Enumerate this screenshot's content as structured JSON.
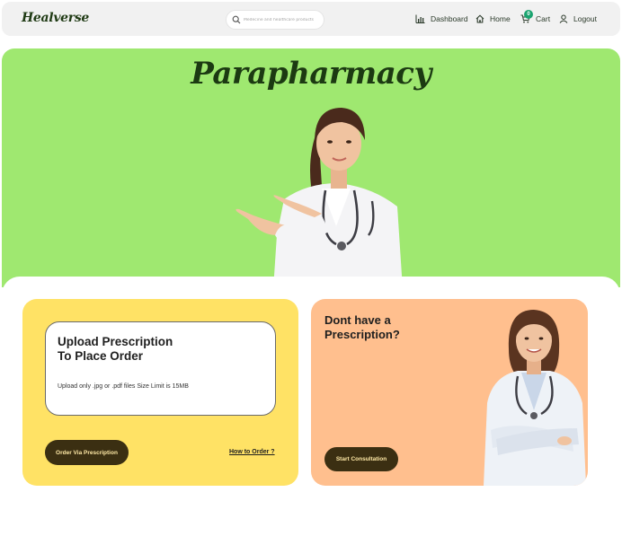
{
  "brand": {
    "logo": "Healverse"
  },
  "search": {
    "placeholder": "Medecine and healthcare products"
  },
  "nav": {
    "dashboard": "Dashboard",
    "home": "Home",
    "cart": "Cart",
    "cart_count": "0",
    "logout": "Logout"
  },
  "hero": {
    "title": "Parapharmacy"
  },
  "upload": {
    "title_line1": "Upload Prescription",
    "title_line2": "To Place Order",
    "note": "Upload only .jpg or .pdf files Size Limit is 15MB",
    "order_button": "Order Via Prescription",
    "how_link": "How to Order ?"
  },
  "consult": {
    "title_line1": "Dont have a",
    "title_line2": "Prescription?",
    "button": "Start Consultation"
  },
  "colors": {
    "hero_bg": "#9fe870",
    "upload_card_bg": "#ffe265",
    "consult_card_bg": "#ffbf8e",
    "button_bg": "#3b2f12",
    "badge": "#1aa36f"
  },
  "icons": [
    "search-icon",
    "chart-icon",
    "home-icon",
    "cart-icon",
    "user-icon"
  ]
}
